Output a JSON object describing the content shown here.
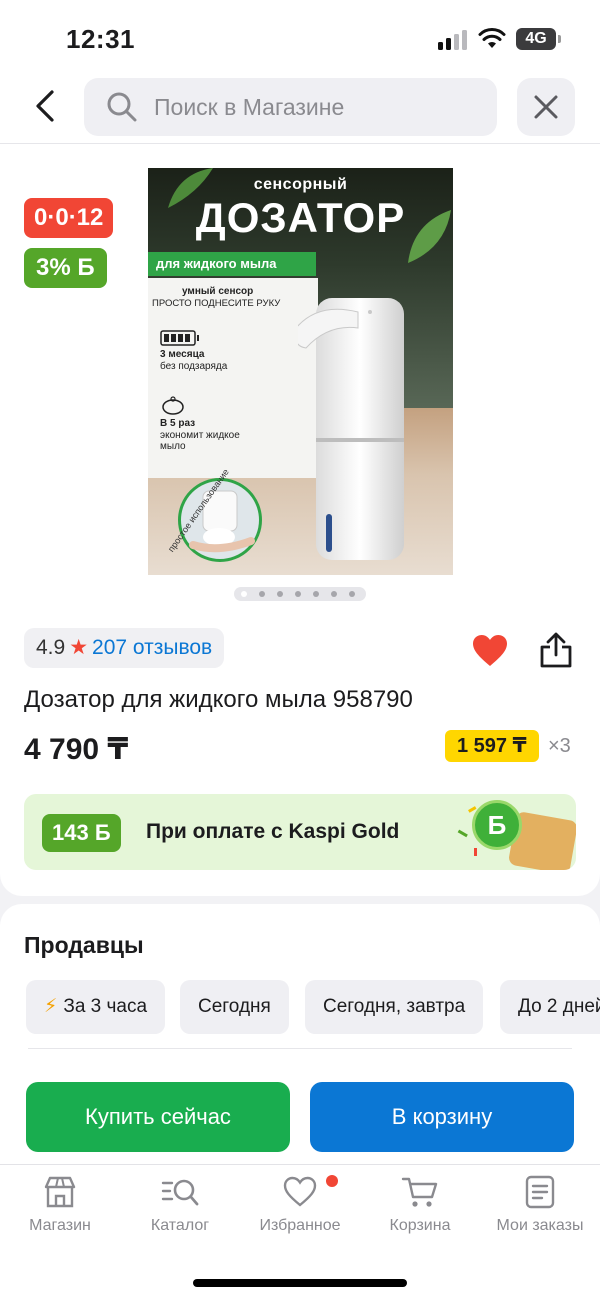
{
  "status": {
    "time": "12:31",
    "network": "4G"
  },
  "nav": {
    "search_placeholder": "Поиск в Магазине"
  },
  "badges": {
    "promo": "0·0·12",
    "bonus": "3% Б"
  },
  "product_image": {
    "line1": "сенсорный",
    "line2": "ДОЗАТОР",
    "strip": "для жидкого мыла",
    "sensor_title": "умный сенсор",
    "sensor_text": "ПРОСТО ПОДНЕСИТЕ РУКУ",
    "battery_title": "3 месяца",
    "battery_text": "без подзаряда",
    "save_title": "В 5 раз",
    "save_text1": "экономит жидкое",
    "save_text2": "мыло",
    "inset_text": "простое использование",
    "slides_total": 7,
    "slide_active": 1
  },
  "product": {
    "rating": "4.9",
    "reviews": "207 отзывов",
    "title": "Дозатор для жидкого мыла 958790",
    "price": "4 790 ₸",
    "installment": "1 597 ₸",
    "installment_multiplier": "×3",
    "favorite": true
  },
  "kaspi_gold": {
    "bonus": "143 Б",
    "text": "При оплате с Kaspi Gold",
    "coin": "Б"
  },
  "sellers": {
    "title": "Продавцы",
    "filters": [
      "За 3 часа",
      "Сегодня",
      "Сегодня, завтра",
      "До 2 дней"
    ]
  },
  "actions": {
    "buy": "Купить сейчас",
    "cart": "В корзину"
  },
  "tabs": [
    {
      "label": "Магазин",
      "icon": "store-icon"
    },
    {
      "label": "Каталог",
      "icon": "catalog-search-icon"
    },
    {
      "label": "Избранное",
      "icon": "heart-outline-icon"
    },
    {
      "label": "Корзина",
      "icon": "cart-icon"
    },
    {
      "label": "Мои заказы",
      "icon": "orders-icon"
    }
  ],
  "colors": {
    "accent_red": "#f14635",
    "green": "#55a629",
    "blue": "#0b77d4",
    "buy_green": "#19ad4f",
    "yellow": "#ffd600"
  }
}
